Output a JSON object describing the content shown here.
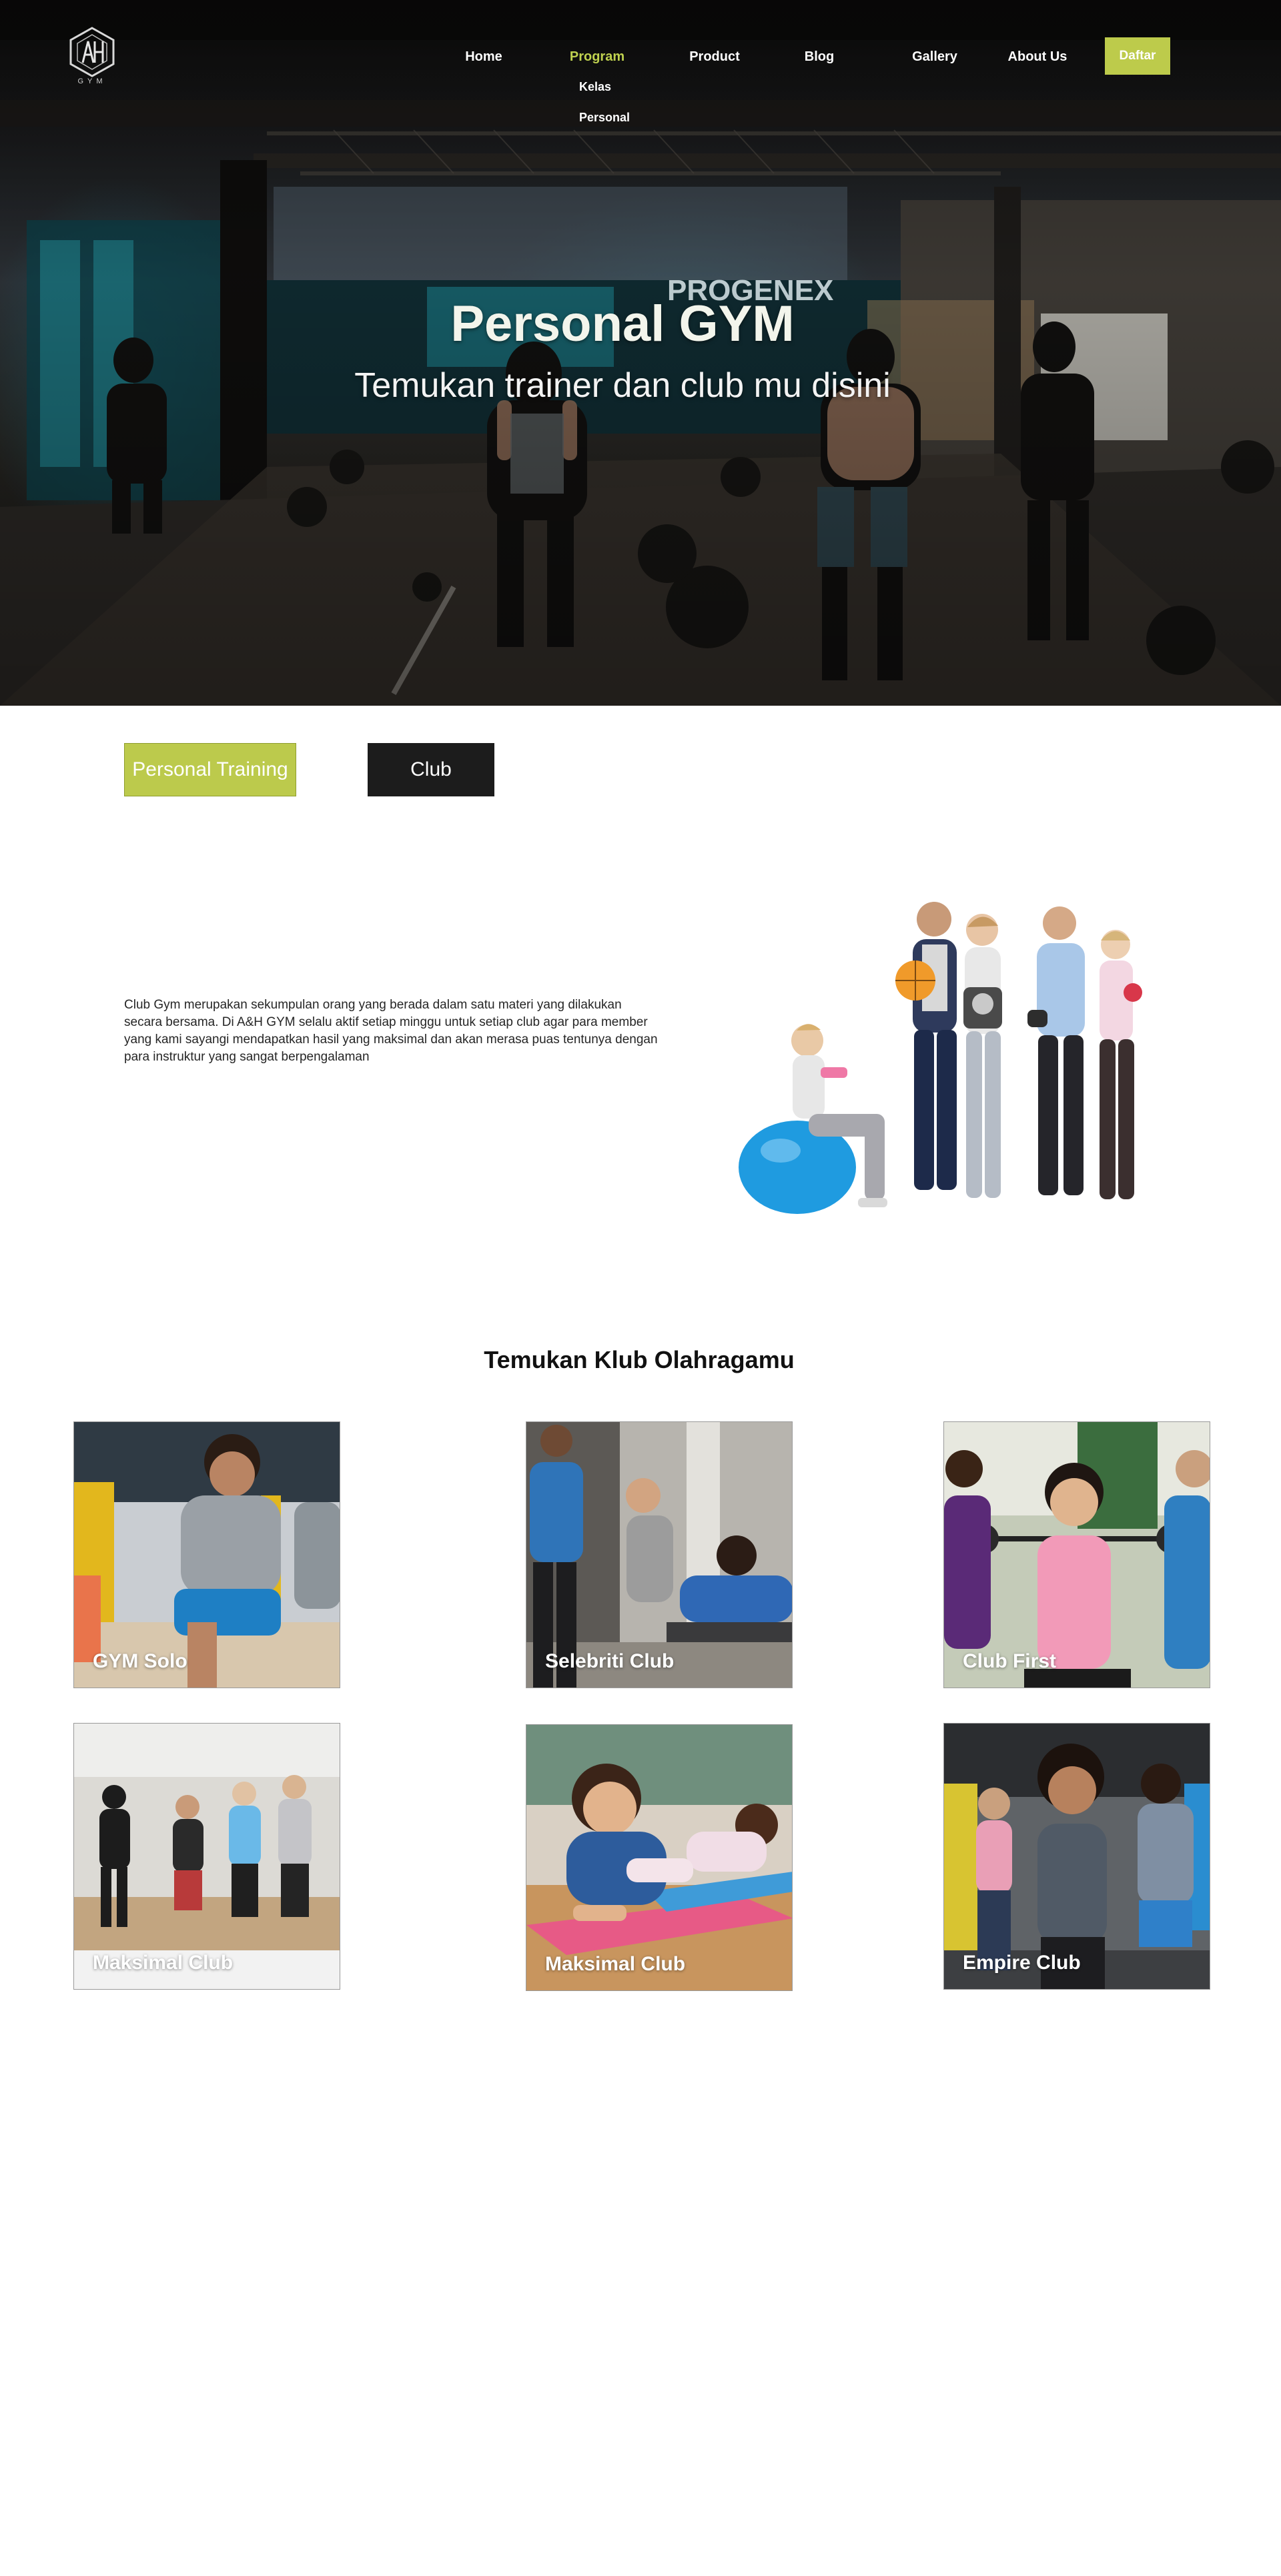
{
  "brand": {
    "logo_text": "GYM"
  },
  "nav": {
    "items": [
      {
        "label": "Home"
      },
      {
        "label": "Program"
      },
      {
        "label": "Product"
      },
      {
        "label": "Blog"
      },
      {
        "label": "Gallery"
      },
      {
        "label": "About Us"
      }
    ],
    "program_submenu": [
      {
        "label": "Kelas"
      },
      {
        "label": "Personal"
      }
    ],
    "cta_label": "Daftar"
  },
  "hero": {
    "title": "Personal GYM",
    "subtitle": "Temukan trainer dan club mu disini",
    "background_sign": "PROGENEX"
  },
  "tabs": [
    {
      "label": "Personal Training",
      "active": true
    },
    {
      "label": "Club",
      "active": false
    }
  ],
  "about": {
    "text": "Club Gym merupakan sekumpulan orang yang berada dalam satu materi yang dilakukan secara bersama. Di A&H GYM selalu aktif setiap minggu untuk setiap club agar para member yang kami sayangi mendapatkan hasil yang maksimal dan akan merasa puas tentunya dengan para instruktur yang sangat berpengalaman"
  },
  "clubs": {
    "title": "Temukan Klub Olahragamu",
    "cards": [
      {
        "label": "GYM Solo"
      },
      {
        "label": "Selebriti Club"
      },
      {
        "label": "Club First"
      },
      {
        "label": "Maksimal Club"
      },
      {
        "label": "Maksimal Club"
      },
      {
        "label": "Empire Club"
      }
    ]
  },
  "colors": {
    "accent": "#bdcb4b",
    "dark_button": "#1c1c1c",
    "nav_active": "#bfd14f",
    "text": "#1a1a1a"
  }
}
